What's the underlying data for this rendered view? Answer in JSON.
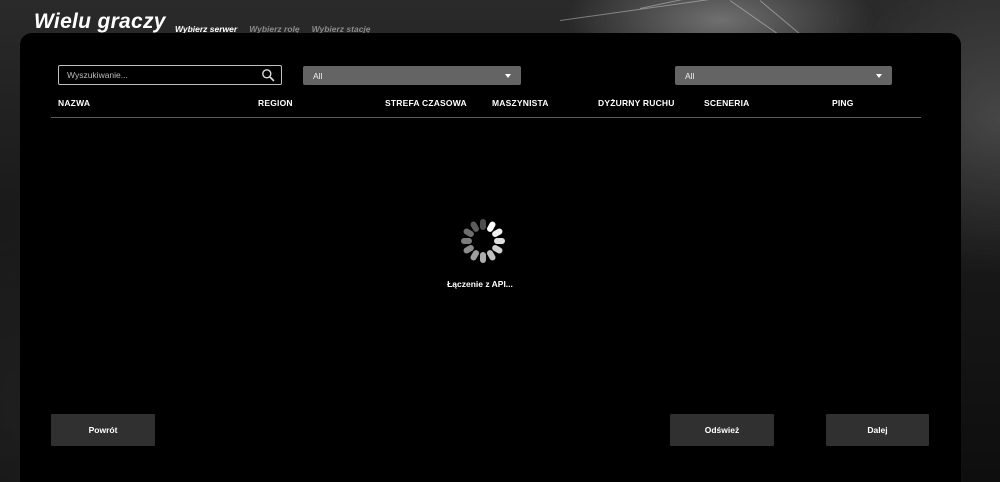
{
  "header": {
    "title": "Wielu graczy",
    "steps": [
      "Wybierz serwer",
      "Wybierz rolę",
      "Wybierz stację"
    ],
    "active_step": 0
  },
  "filters": {
    "search_placeholder": "Wyszukiwanie...",
    "search_value": "",
    "select_one_value": "All",
    "select_two_value": "All"
  },
  "table": {
    "columns": [
      "NAZWA",
      "REGION",
      "STREFA CZASOWA",
      "MASZYNISTA",
      "DYŻURNY RUCHU",
      "SCENERIA",
      "PING"
    ]
  },
  "status": {
    "loading_text": "Łączenie z API..."
  },
  "buttons": {
    "back": "Powrót",
    "refresh": "Odśwież",
    "next": "Dalej"
  },
  "icons": {
    "search": "search-icon",
    "dropdown": "chevron-down-icon",
    "loading": "spinner-icon"
  },
  "colors": {
    "panel": "#000000",
    "select_bg": "#646464",
    "button_bg": "#303030",
    "inactive_step": "#8a8a8a"
  }
}
